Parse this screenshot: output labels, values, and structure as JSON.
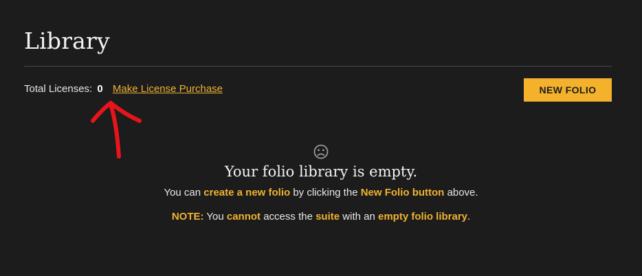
{
  "header": {
    "title": "Library"
  },
  "licenses": {
    "label": "Total Licenses:",
    "count": "0",
    "purchase_link": "Make License Purchase"
  },
  "toolbar": {
    "new_folio_label": "NEW FOLIO"
  },
  "annotation": {
    "arrow_color": "#e8141c"
  },
  "empty_state": {
    "icon": "sad-face-icon",
    "heading": "Your folio library is empty.",
    "line1": {
      "part1": "You can ",
      "link1": "create a new folio",
      "part2": " by clicking the ",
      "link2": "New Folio button",
      "part3": " above."
    },
    "note": {
      "label": "NOTE:",
      "part1": " You ",
      "emph1": "cannot",
      "part2": " access the ",
      "emph2": "suite",
      "part3": " with an ",
      "emph3": "empty folio library",
      "part4": "."
    }
  },
  "colors": {
    "background": "#1c1c1c",
    "accent": "#f4b12c",
    "text": "#eaeaea"
  }
}
